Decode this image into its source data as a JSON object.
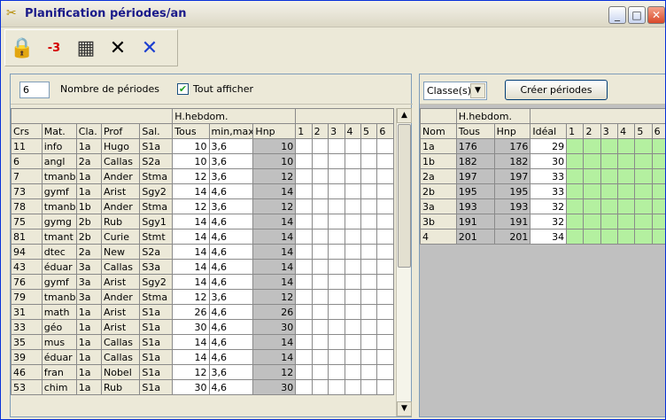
{
  "window": {
    "title": "Planification périodes/an",
    "min_label": "_",
    "max_label": "□",
    "close_label": "✕"
  },
  "toolbar": [
    {
      "name": "lock-icon",
      "glyph": "🔒"
    },
    {
      "name": "minus3-icon",
      "glyph": "-3"
    },
    {
      "name": "calculator-icon",
      "glyph": "▦"
    },
    {
      "name": "cross-black-icon",
      "glyph": "✕"
    },
    {
      "name": "cross-blue-icon",
      "glyph": "✕"
    }
  ],
  "left": {
    "period_count": "6",
    "period_count_label": "Nombre de périodes",
    "show_all_label": "Tout afficher",
    "show_all_checked": true,
    "group_header": "H.hebdom.",
    "headers": [
      "Crs",
      "Mat.",
      "Cla.",
      "Prof",
      "Sal.",
      "Tous",
      "min,max",
      "Hnp",
      "1",
      "2",
      "3",
      "4",
      "5",
      "6"
    ],
    "rows": [
      [
        "11",
        "info",
        "1a",
        "Hugo",
        "S1a",
        "10",
        "3,6",
        "10"
      ],
      [
        "6",
        "angl",
        "2a",
        "Callas",
        "S2a",
        "10",
        "3,6",
        "10"
      ],
      [
        "7",
        "tmanb",
        "1a",
        "Ander",
        "Stma",
        "12",
        "3,6",
        "12"
      ],
      [
        "73",
        "gymf",
        "1a",
        "Arist",
        "Sgy2",
        "14",
        "4,6",
        "14"
      ],
      [
        "78",
        "tmanb",
        "1b",
        "Ander",
        "Stma",
        "12",
        "3,6",
        "12"
      ],
      [
        "75",
        "gymg",
        "2b",
        "Rub",
        "Sgy1",
        "14",
        "4,6",
        "14"
      ],
      [
        "81",
        "tmant",
        "2b",
        "Curie",
        "Stmt",
        "14",
        "4,6",
        "14"
      ],
      [
        "94",
        "dtec",
        "2a",
        "New",
        "S2a",
        "14",
        "4,6",
        "14"
      ],
      [
        "43",
        "éduar",
        "3a",
        "Callas",
        "S3a",
        "14",
        "4,6",
        "14"
      ],
      [
        "76",
        "gymf",
        "3a",
        "Arist",
        "Sgy2",
        "14",
        "4,6",
        "14"
      ],
      [
        "79",
        "tmanb",
        "3a",
        "Ander",
        "Stma",
        "12",
        "3,6",
        "12"
      ],
      [
        "31",
        "math",
        "1a",
        "Arist",
        "S1a",
        "26",
        "4,6",
        "26"
      ],
      [
        "33",
        "géo",
        "1a",
        "Arist",
        "S1a",
        "30",
        "4,6",
        "30"
      ],
      [
        "35",
        "mus",
        "1a",
        "Callas",
        "S1a",
        "14",
        "4,6",
        "14"
      ],
      [
        "39",
        "éduar",
        "1a",
        "Callas",
        "S1a",
        "14",
        "4,6",
        "14"
      ],
      [
        "46",
        "fran",
        "1a",
        "Nobel",
        "S1a",
        "12",
        "3,6",
        "12"
      ],
      [
        "53",
        "chim",
        "1a",
        "Rub",
        "S1a",
        "30",
        "4,6",
        "30"
      ]
    ]
  },
  "right": {
    "class_select": "Classe(s)",
    "create_button": "Créer périodes",
    "group_header": "H.hebdom.",
    "headers": [
      "Nom",
      "Tous",
      "Hnp",
      "Idéal",
      "1",
      "2",
      "3",
      "4",
      "5",
      "6"
    ],
    "rows": [
      [
        "1a",
        "176",
        "176",
        "29"
      ],
      [
        "1b",
        "182",
        "182",
        "30"
      ],
      [
        "2a",
        "197",
        "197",
        "33"
      ],
      [
        "2b",
        "195",
        "195",
        "33"
      ],
      [
        "3a",
        "193",
        "193",
        "32"
      ],
      [
        "3b",
        "191",
        "191",
        "32"
      ],
      [
        "4",
        "201",
        "201",
        "34"
      ]
    ]
  },
  "colors": {
    "title_text": "#1a1a8a",
    "green_cell": "#b4f0a0",
    "gray_cell": "#c0c0c0",
    "header_bg": "#ece9d8"
  }
}
